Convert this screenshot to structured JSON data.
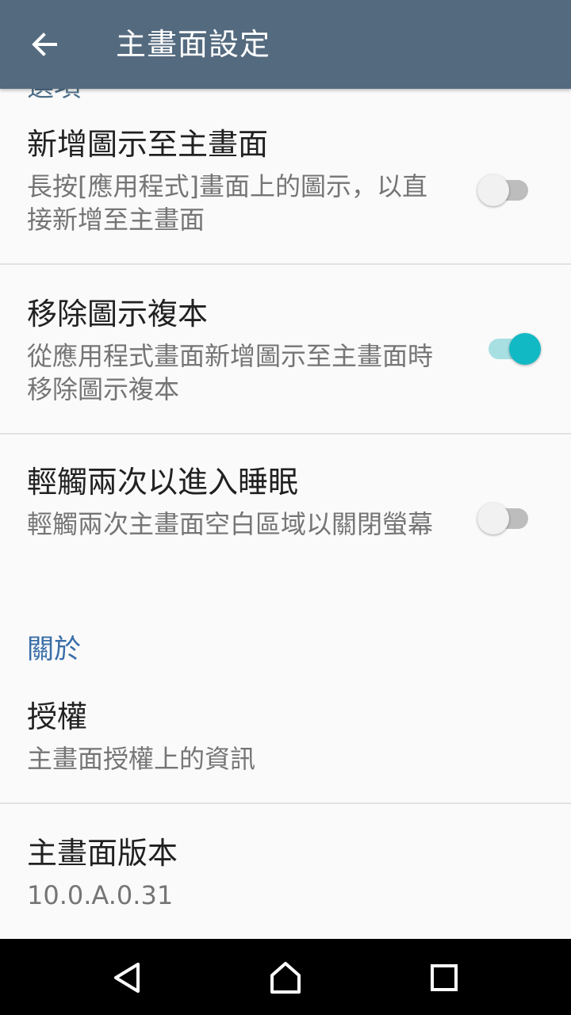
{
  "appbar": {
    "title": "主畫面設定"
  },
  "partial_header": "選項",
  "items": [
    {
      "title": "新增圖示至主畫面",
      "summary": "長按[應用程式]畫面上的圖示，以直接新增至主畫面",
      "toggle_on": false
    },
    {
      "title": "移除圖示複本",
      "summary": "從應用程式畫面新增圖示至主畫面時移除圖示複本",
      "toggle_on": true
    },
    {
      "title": "輕觸兩次以進入睡眠",
      "summary": "輕觸兩次主畫面空白區域以關閉螢幕",
      "toggle_on": false
    }
  ],
  "about": {
    "header": "關於",
    "license": {
      "title": "授權",
      "summary": "主畫面授權上的資訊"
    },
    "version": {
      "title": "主畫面版本",
      "summary": "10.0.A.0.31"
    }
  },
  "colors": {
    "appbar": "#546a7f",
    "accent": "#11b9c5",
    "section_header": "#3a6ea8"
  },
  "navbar": {
    "icons": [
      "back-triangle-icon",
      "home-icon",
      "recents-square-icon"
    ]
  }
}
